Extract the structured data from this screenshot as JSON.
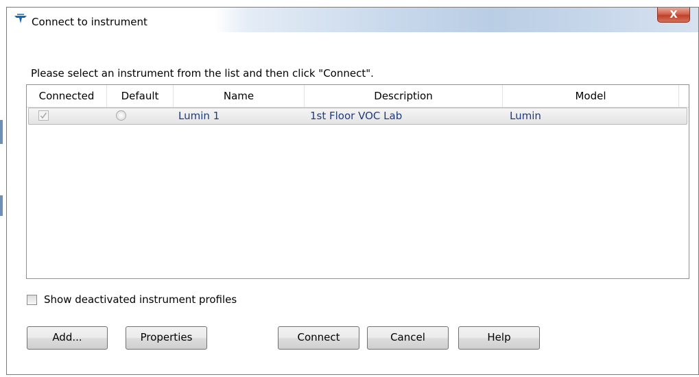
{
  "window": {
    "title": "Connect to instrument",
    "close_label": "X"
  },
  "prompt": "Please select an instrument from the list and then click \"Connect\".",
  "table": {
    "columns": [
      "Connected",
      "Default",
      "Name",
      "Description",
      "Model"
    ],
    "rows": [
      {
        "connected": true,
        "default": false,
        "name": "Lumin 1",
        "description": "1st Floor VOC Lab",
        "model": "Lumin"
      }
    ]
  },
  "show_deactivated": {
    "label": "Show deactivated instrument profiles",
    "checked": false
  },
  "buttons": {
    "add": "Add...",
    "properties": "Properties",
    "connect": "Connect",
    "cancel": "Cancel",
    "help": "Help"
  },
  "colors": {
    "row_text": "#1f3a7a",
    "close_button": "#c0402a",
    "logo": "#1565b8"
  },
  "icons": {
    "title_icon": "teledyne-logo-icon",
    "check": "checkmark-icon"
  }
}
